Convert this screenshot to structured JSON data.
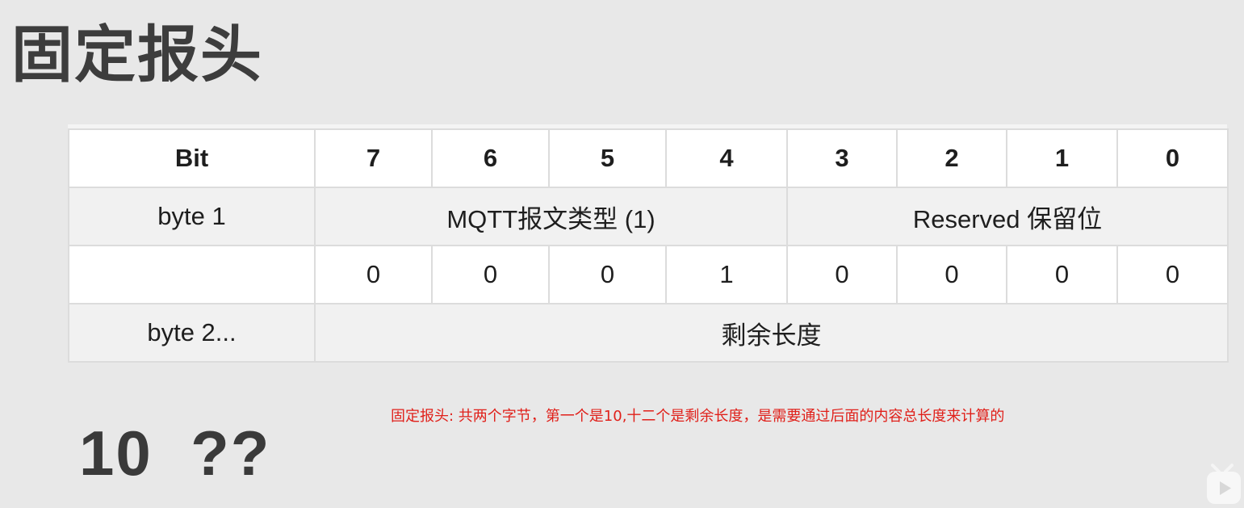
{
  "slide": {
    "title": "固定报头",
    "big_value": "10  ??",
    "note": "固定报头: 共两个字节，第一个是10,十二个是剩余长度，是需要通过后面的内容总长度来计算的"
  },
  "table": {
    "header": [
      "Bit",
      "7",
      "6",
      "5",
      "4",
      "3",
      "2",
      "1",
      "0"
    ],
    "byte1": {
      "label": "byte 1",
      "type_field": "MQTT报文类型 (1)",
      "reserved_field": "Reserved 保留位"
    },
    "bits_row": {
      "label": "",
      "values": [
        "0",
        "0",
        "0",
        "1",
        "0",
        "0",
        "0",
        "0"
      ]
    },
    "byte2": {
      "label": "byte 2...",
      "field": "剩余长度"
    }
  },
  "icons": {
    "corner": "video-play-icon"
  }
}
